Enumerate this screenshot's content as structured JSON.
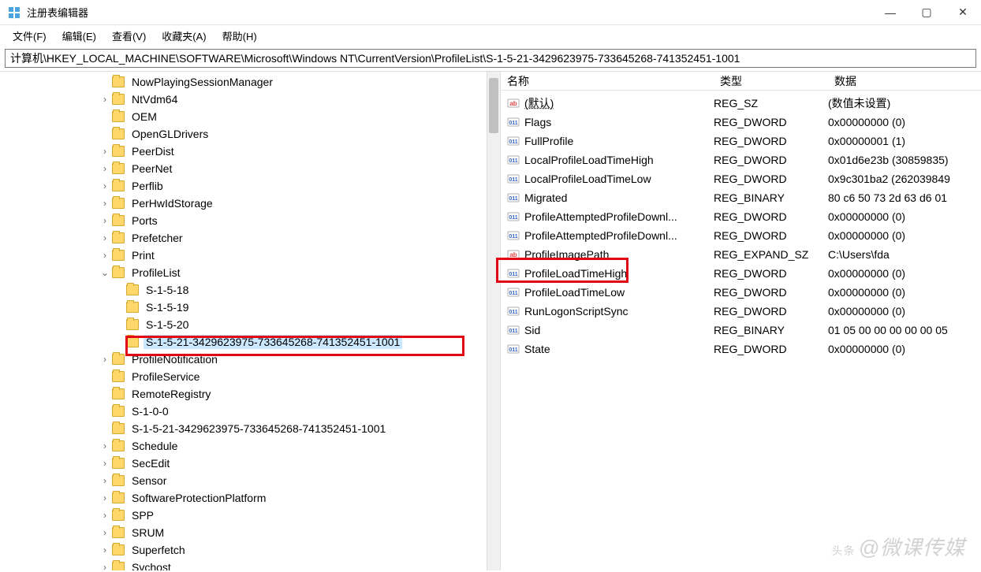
{
  "window": {
    "title": "注册表编辑器"
  },
  "menubar": [
    "文件(F)",
    "编辑(E)",
    "查看(V)",
    "收藏夹(A)",
    "帮助(H)"
  ],
  "addressbar": "计算机\\HKEY_LOCAL_MACHINE\\SOFTWARE\\Microsoft\\Windows NT\\CurrentVersion\\ProfileList\\S-1-5-21-3429623975-733645268-741352451-1001",
  "tree": [
    {
      "indent": 7,
      "exp": "",
      "label": "NowPlayingSessionManager"
    },
    {
      "indent": 7,
      "exp": "›",
      "label": "NtVdm64"
    },
    {
      "indent": 7,
      "exp": "",
      "label": "OEM"
    },
    {
      "indent": 7,
      "exp": "",
      "label": "OpenGLDrivers"
    },
    {
      "indent": 7,
      "exp": "›",
      "label": "PeerDist"
    },
    {
      "indent": 7,
      "exp": "›",
      "label": "PeerNet"
    },
    {
      "indent": 7,
      "exp": "›",
      "label": "Perflib"
    },
    {
      "indent": 7,
      "exp": "›",
      "label": "PerHwIdStorage"
    },
    {
      "indent": 7,
      "exp": "›",
      "label": "Ports"
    },
    {
      "indent": 7,
      "exp": "›",
      "label": "Prefetcher"
    },
    {
      "indent": 7,
      "exp": "›",
      "label": "Print"
    },
    {
      "indent": 7,
      "exp": "⌄",
      "label": "ProfileList"
    },
    {
      "indent": 8,
      "exp": "",
      "label": "S-1-5-18"
    },
    {
      "indent": 8,
      "exp": "",
      "label": "S-1-5-19"
    },
    {
      "indent": 8,
      "exp": "",
      "label": "S-1-5-20"
    },
    {
      "indent": 8,
      "exp": "",
      "label": "S-1-5-21-3429623975-733645268-741352451-1001",
      "selected": true
    },
    {
      "indent": 7,
      "exp": "›",
      "label": "ProfileNotification"
    },
    {
      "indent": 7,
      "exp": "",
      "label": "ProfileService"
    },
    {
      "indent": 7,
      "exp": "",
      "label": "RemoteRegistry"
    },
    {
      "indent": 7,
      "exp": "",
      "label": "S-1-0-0"
    },
    {
      "indent": 7,
      "exp": "",
      "label": "S-1-5-21-3429623975-733645268-741352451-1001"
    },
    {
      "indent": 7,
      "exp": "›",
      "label": "Schedule"
    },
    {
      "indent": 7,
      "exp": "›",
      "label": "SecEdit"
    },
    {
      "indent": 7,
      "exp": "›",
      "label": "Sensor"
    },
    {
      "indent": 7,
      "exp": "›",
      "label": "SoftwareProtectionPlatform"
    },
    {
      "indent": 7,
      "exp": "›",
      "label": "SPP"
    },
    {
      "indent": 7,
      "exp": "›",
      "label": "SRUM"
    },
    {
      "indent": 7,
      "exp": "›",
      "label": "Superfetch"
    },
    {
      "indent": 7,
      "exp": "›",
      "label": "Svchost"
    }
  ],
  "columns": {
    "name": "名称",
    "type": "类型",
    "data": "数据"
  },
  "values": [
    {
      "icon": "str",
      "name": "(默认)",
      "type": "REG_SZ",
      "data": "(数值未设置)",
      "default": true
    },
    {
      "icon": "bin",
      "name": "Flags",
      "type": "REG_DWORD",
      "data": "0x00000000 (0)"
    },
    {
      "icon": "bin",
      "name": "FullProfile",
      "type": "REG_DWORD",
      "data": "0x00000001 (1)"
    },
    {
      "icon": "bin",
      "name": "LocalProfileLoadTimeHigh",
      "type": "REG_DWORD",
      "data": "0x01d6e23b (30859835)"
    },
    {
      "icon": "bin",
      "name": "LocalProfileLoadTimeLow",
      "type": "REG_DWORD",
      "data": "0x9c301ba2 (262039849"
    },
    {
      "icon": "bin",
      "name": "Migrated",
      "type": "REG_BINARY",
      "data": "80 c6 50 73 2d 63 d6 01"
    },
    {
      "icon": "bin",
      "name": "ProfileAttemptedProfileDownl...",
      "type": "REG_DWORD",
      "data": "0x00000000 (0)"
    },
    {
      "icon": "bin",
      "name": "ProfileAttemptedProfileDownl...",
      "type": "REG_DWORD",
      "data": "0x00000000 (0)"
    },
    {
      "icon": "str",
      "name": "ProfileImagePath",
      "type": "REG_EXPAND_SZ",
      "data": "C:\\Users\\fda"
    },
    {
      "icon": "bin",
      "name": "ProfileLoadTimeHigh",
      "type": "REG_DWORD",
      "data": "0x00000000 (0)"
    },
    {
      "icon": "bin",
      "name": "ProfileLoadTimeLow",
      "type": "REG_DWORD",
      "data": "0x00000000 (0)"
    },
    {
      "icon": "bin",
      "name": "RunLogonScriptSync",
      "type": "REG_DWORD",
      "data": "0x00000000 (0)"
    },
    {
      "icon": "bin",
      "name": "Sid",
      "type": "REG_BINARY",
      "data": "01 05 00 00 00 00 00 05"
    },
    {
      "icon": "bin",
      "name": "State",
      "type": "REG_DWORD",
      "data": "0x00000000 (0)"
    }
  ],
  "watermark": {
    "prefix": "头条",
    "text": "@微课传媒"
  }
}
